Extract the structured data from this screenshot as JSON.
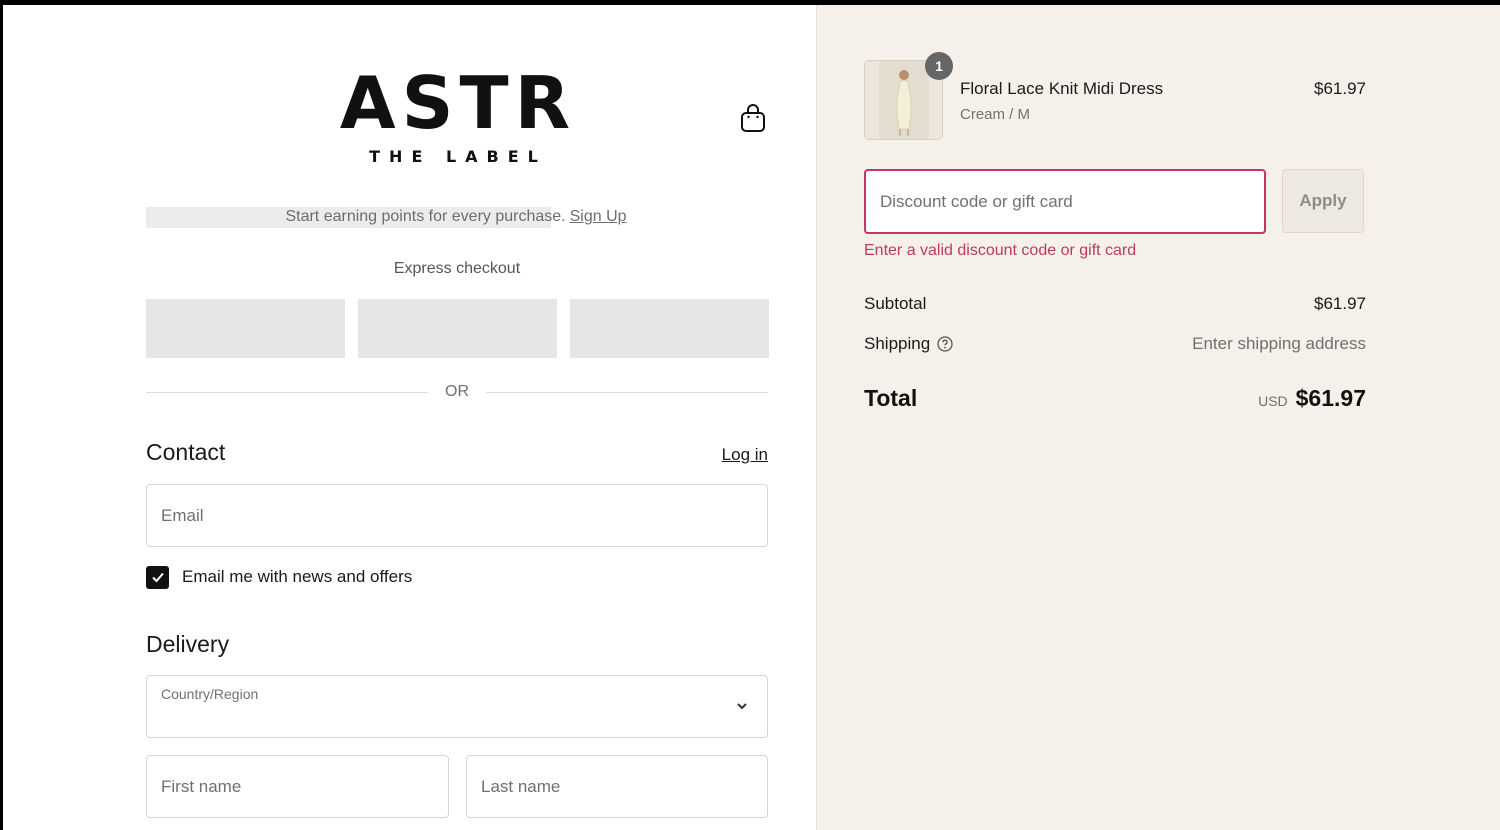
{
  "brand": {
    "name": "ASTR",
    "tagline": "THE LABEL"
  },
  "header": {
    "cart_icon": "shopping-bag-icon"
  },
  "loyalty": {
    "text": "Start earning points for every purchase.",
    "link": "Sign Up"
  },
  "express": {
    "title": "Express checkout",
    "divider": "OR"
  },
  "contact": {
    "title": "Contact",
    "login_link": "Log in",
    "email_placeholder": "Email",
    "newsletter_label": "Email me with news and offers",
    "newsletter_checked": true
  },
  "delivery": {
    "title": "Delivery",
    "country_label": "Country/Region",
    "country_value": "",
    "first_name_placeholder": "First name",
    "last_name_placeholder": "Last name"
  },
  "order": {
    "item": {
      "name": "Floral Lace Knit Midi Dress",
      "variant": "Cream / M",
      "price": "$61.97",
      "quantity": "1"
    },
    "discount": {
      "placeholder": "Discount code or gift card",
      "apply_label": "Apply",
      "error": "Enter a valid discount code or gift card"
    },
    "summary": {
      "subtotal_label": "Subtotal",
      "subtotal_value": "$61.97",
      "shipping_label": "Shipping",
      "shipping_value": "Enter shipping address",
      "total_label": "Total",
      "currency": "USD",
      "total_value": "$61.97"
    }
  },
  "colors": {
    "error": "#c0385e",
    "summary_bg": "#f5f1ea",
    "express_button": "#e6e6e6"
  }
}
